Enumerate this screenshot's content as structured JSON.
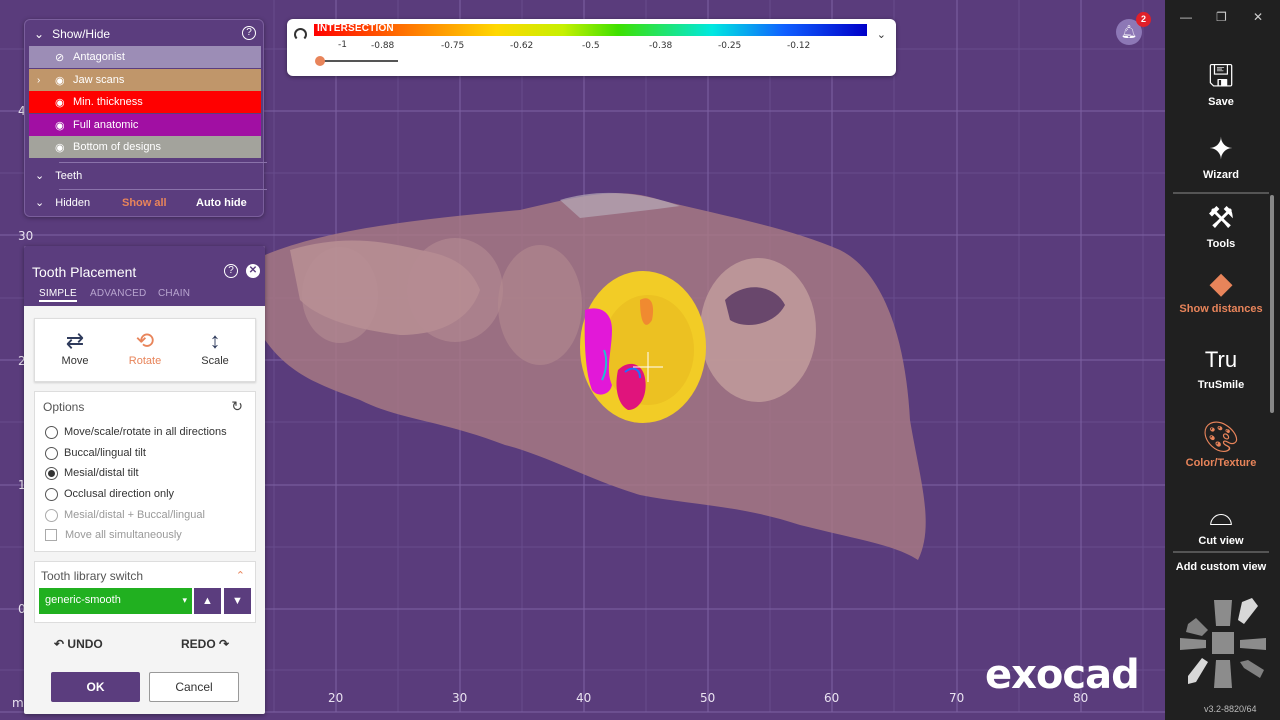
{
  "colorbar": {
    "title": "INTERSECTION",
    "ticks": [
      "-1",
      "-0.88",
      "-0.75",
      "-0.62",
      "-0.5",
      "-0.38",
      "-0.25",
      "-0.12"
    ]
  },
  "show_hide": {
    "title": "Show/Hide",
    "help": "?",
    "layers": [
      {
        "label": "Antagonist",
        "color": "#9c8db6"
      },
      {
        "label": "Jaw scans",
        "color": "#c0966a"
      },
      {
        "label": "Min. thickness",
        "color": "#ff0000"
      },
      {
        "label": "Full anatomic",
        "color": "#a10fa3"
      },
      {
        "label": "Bottom of designs",
        "color": "#a3a39c"
      }
    ],
    "teeth": "Teeth",
    "hidden": "Hidden",
    "show_all": "Show all",
    "auto_hide": "Auto hide"
  },
  "tooth_placement": {
    "title": "Tooth Placement",
    "tabs": [
      "SIMPLE",
      "ADVANCED",
      "CHAIN"
    ],
    "tools": [
      {
        "label": "Move",
        "icon": "move-icon"
      },
      {
        "label": "Rotate",
        "icon": "rotate-icon"
      },
      {
        "label": "Scale",
        "icon": "scale-icon"
      }
    ],
    "options_title": "Options",
    "options": [
      "Move/scale/rotate in all directions",
      "Buccal/lingual tilt",
      "Mesial/distal tilt",
      "Occlusal direction only",
      "Mesial/distal + Buccal/lingual"
    ],
    "selected_option": "Mesial/distal tilt",
    "move_all": "Move all simultaneously",
    "library_title": "Tooth library switch",
    "library_value": "generic-smooth",
    "undo": "UNDO",
    "redo": "REDO",
    "ok": "OK",
    "cancel": "Cancel"
  },
  "notifications": {
    "count": "2"
  },
  "logo": "exocad",
  "axis": {
    "x": [
      "20",
      "30",
      "40",
      "50",
      "60",
      "70",
      "80"
    ],
    "y": [
      "4",
      "30",
      "2",
      "1",
      "0"
    ],
    "corner": "m"
  },
  "sidebar": {
    "items": [
      {
        "label": "Save",
        "icon": "save-icon"
      },
      {
        "label": "Wizard",
        "icon": "wand-icon"
      },
      {
        "label": "Tools",
        "icon": "tools-icon"
      },
      {
        "label": "Show distances",
        "icon": "distance-icon"
      },
      {
        "label": "TruSmile",
        "icon": "trusmile-icon",
        "glyph": "Tru"
      },
      {
        "label": "Color/Texture",
        "icon": "palette-icon"
      },
      {
        "label": "Cut view",
        "icon": "cut-view-icon"
      }
    ],
    "add_custom_view": "Add custom view",
    "version": "v3.2-8820/64"
  }
}
